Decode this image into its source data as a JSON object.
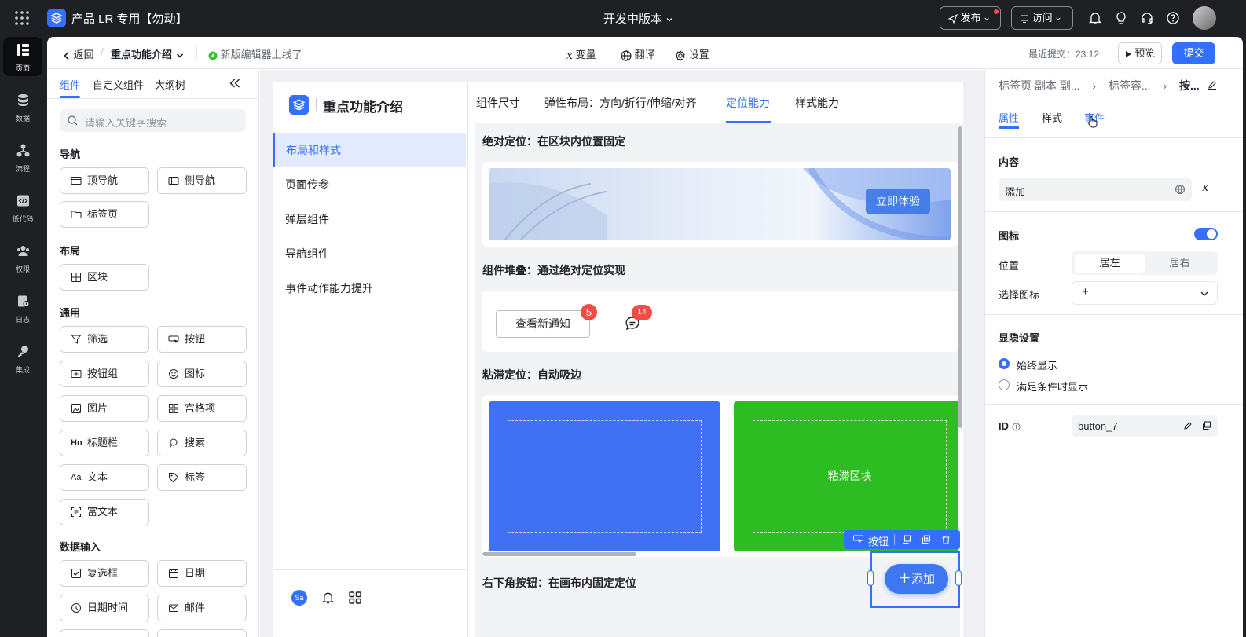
{
  "topbar": {
    "app_title": "产品 LR 专用【勿动】",
    "version_label": "开发中版本",
    "publish_label": "发布",
    "visit_label": "访问"
  },
  "rail": {
    "items": [
      {
        "label": "页面",
        "icon": "page-icon"
      },
      {
        "label": "数据",
        "icon": "database-icon"
      },
      {
        "label": "流程",
        "icon": "flow-icon"
      },
      {
        "label": "低代码",
        "icon": "code-icon"
      },
      {
        "label": "权限",
        "icon": "users-icon"
      },
      {
        "label": "日志",
        "icon": "log-icon"
      },
      {
        "label": "集成",
        "icon": "key-icon"
      }
    ]
  },
  "toolbar": {
    "back_label": "返回",
    "page_name": "重点功能介绍",
    "notice": "新版编辑器上线了",
    "variable_label": "变量",
    "translate_label": "翻译",
    "settings_label": "设置",
    "last_commit": "最近提交：23:12",
    "preview_label": "预览",
    "submit_label": "提交"
  },
  "left_panel": {
    "tabs": [
      "组件",
      "自定义组件",
      "大纲树"
    ],
    "search_placeholder": "请输入关键字搜索",
    "sections": {
      "nav": "导航",
      "layout": "布局",
      "common": "通用",
      "input": "数据输入"
    },
    "components": {
      "top_nav": "顶导航",
      "side_nav": "侧导航",
      "tab_page": "标签页",
      "block": "区块",
      "filter": "筛选",
      "button": "按钮",
      "button_group": "按钮组",
      "icon": "图标",
      "image": "图片",
      "grid_item": "宫格项",
      "title_bar": "标题栏",
      "search": "搜索",
      "text": "文本",
      "tag": "标签",
      "rich_text": "富文本",
      "checkbox": "复选框",
      "date": "日期",
      "datetime": "日期时间",
      "email": "邮件"
    }
  },
  "canvas": {
    "app_name": "重点功能介绍",
    "nav_items": [
      "布局和样式",
      "页面传参",
      "弹层组件",
      "导航组件",
      "事件动作能力提升"
    ],
    "avatar_text": "Sa",
    "tabs": [
      "组件尺寸",
      "弹性布局：方向/折行/伸缩/对齐",
      "定位能力",
      "样式能力"
    ],
    "headings": {
      "absolute": "绝对定位：在区块内位置固定",
      "stack": "组件堆叠：通过绝对定位实现",
      "sticky": "粘滞定位：自动吸边",
      "fixed": "右下角按钮：在画布内固定定位"
    },
    "try_now": "立即体验",
    "view_notice": "查看新通知",
    "badge_count": "5",
    "badge_count_2": "14",
    "sticky_block": "粘滞区块",
    "selection_label": "按钮",
    "add_button": "添加"
  },
  "right_panel": {
    "breadcrumb": [
      "标签页 副本 副...",
      "标签容...",
      "按..."
    ],
    "tabs": [
      "属性",
      "样式",
      "事件"
    ],
    "content_label": "内容",
    "content_value": "添加",
    "icon_label": "图标",
    "icon_enabled": true,
    "position_label": "位置",
    "position_options": [
      "居左",
      "居右"
    ],
    "select_icon_label": "选择图标",
    "select_icon_value": "+",
    "visibility_label": "显隐设置",
    "visibility_options": [
      "始终显示",
      "满足条件时显示"
    ],
    "id_label": "ID",
    "id_value": "button_7"
  },
  "colors": {
    "accent": "#3370ff",
    "blue_block": "#4071f4",
    "green_block": "#2dbc22",
    "badge": "#f54a45"
  }
}
